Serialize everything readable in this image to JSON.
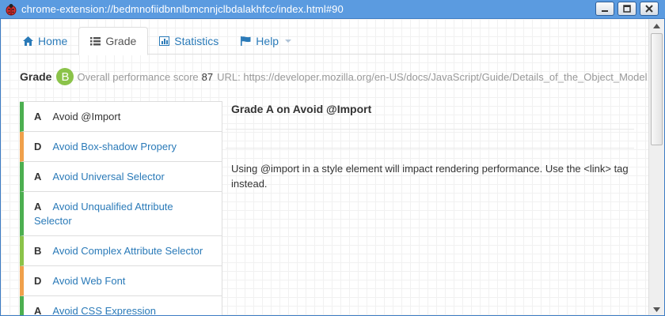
{
  "window": {
    "title": "chrome-extension://bedmnofiidbnnlbmcnnjclbdalakhfcc/index.html#90"
  },
  "tabs": [
    {
      "label": "Home",
      "icon": "home-icon",
      "active": false
    },
    {
      "label": "Grade",
      "icon": "list-icon",
      "active": true
    },
    {
      "label": "Statistics",
      "icon": "chart-icon",
      "active": false
    },
    {
      "label": "Help",
      "icon": "flag-icon",
      "active": false
    }
  ],
  "summary": {
    "grade_label": "Grade",
    "grade_letter": "B",
    "grade_color": "#8bc34a",
    "score_label": "Overall performance score",
    "score_value": "87",
    "url_label": "URL: https://developer.mozilla.org/en-US/docs/JavaScript/Guide/Details_of_the_Object_Model"
  },
  "rules": [
    {
      "grade": "A",
      "name": "Avoid @Import",
      "color": "#4caf50",
      "active": true
    },
    {
      "grade": "D",
      "name": "Avoid Box-shadow Propery",
      "color": "#f0a04b",
      "active": false
    },
    {
      "grade": "A",
      "name": "Avoid Universal Selector",
      "color": "#4caf50",
      "active": false
    },
    {
      "grade": "A",
      "name": "Avoid Unqualified Attribute Selector",
      "color": "#4caf50",
      "active": false
    },
    {
      "grade": "B",
      "name": "Avoid Complex Attribute Selector",
      "color": "#8bc34a",
      "active": false
    },
    {
      "grade": "D",
      "name": "Avoid Web Font",
      "color": "#f0a04b",
      "active": false
    },
    {
      "grade": "A",
      "name": "Avoid CSS Expression",
      "color": "#4caf50",
      "active": false
    }
  ],
  "detail": {
    "title": "Grade A on Avoid @Import",
    "body": "Using @import in a style element will impact rendering performance. Use the <link> tag instead."
  }
}
